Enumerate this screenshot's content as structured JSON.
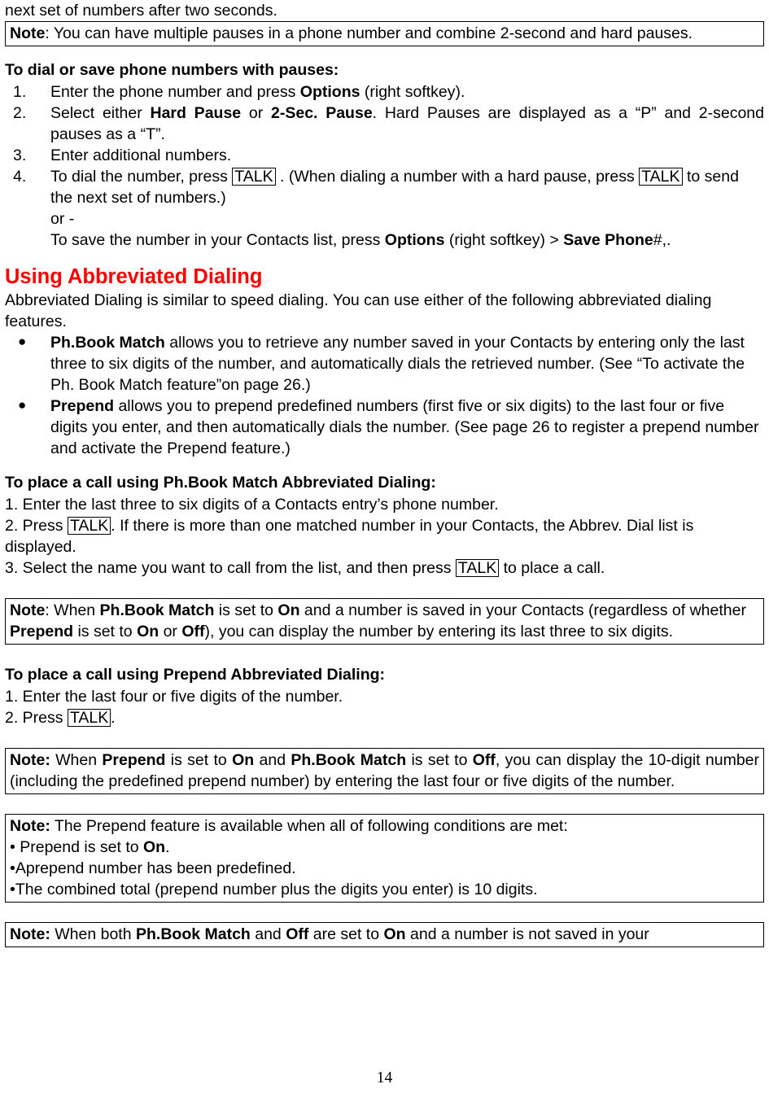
{
  "page": {
    "number": "14"
  },
  "top_fragment": "next set of numbers after two seconds.",
  "note1": {
    "label": "Note",
    "colon": ": ",
    "text": "You can have multiple pauses in a phone number and combine 2-second and hard pauses."
  },
  "section_dial": {
    "heading": "To dial or save phone numbers with pauses:",
    "steps": [
      {
        "num": "1.",
        "parts": [
          {
            "t": "Enter the phone number and press ",
            "style": "normal"
          },
          {
            "t": "Options",
            "style": "bold"
          },
          {
            "t": " (right softkey).",
            "style": "normal"
          }
        ]
      },
      {
        "num": "2.",
        "parts": [
          {
            "t": "Select either ",
            "style": "normal"
          },
          {
            "t": "Hard Pause",
            "style": "bold"
          },
          {
            "t": " or ",
            "style": "normal"
          },
          {
            "t": "2-Sec. Pause",
            "style": "bold"
          },
          {
            "t": ". Hard Pauses are displayed as a “P” and 2-second pauses as a “T”.",
            "style": "normal"
          }
        ]
      },
      {
        "num": "3.",
        "parts": [
          {
            "t": "Enter additional numbers.",
            "style": "normal"
          }
        ]
      }
    ],
    "step4": {
      "num": "4.",
      "a_pre": "To dial the number, press ",
      "a_key1": "TALK",
      "a_mid": " . (When dialing a number with a hard pause, press ",
      "a_key2": "TALK",
      "a_post": "to send the next set of numbers.)",
      "or": "or -",
      "b_pre": "To save the number in your Contacts list, press ",
      "b_bold1": "Options",
      "b_mid": " (right softkey) > ",
      "b_bold2": "Save Phone",
      "b_post": "#,."
    }
  },
  "section_abbrev": {
    "heading": "Using Abbreviated Dialing",
    "intro": "Abbreviated Dialing is similar to speed dialing. You can use either of the following abbreviated dialing features.",
    "bullets": [
      {
        "marker": "●",
        "parts": [
          {
            "t": "Ph.Book Match",
            "style": "bold"
          },
          {
            "t": " allows you to retrieve any number saved in your Contacts by entering only the last three to six digits of the number, and automatically dials the retrieved number. (See “To activate the Ph. Book Match feature”on page 26.)",
            "style": "normal"
          }
        ]
      },
      {
        "marker": "●",
        "parts": [
          {
            "t": "Prepend",
            "style": "bold"
          },
          {
            "t": " allows you to prepend predefined numbers (first five or six digits) to the last four or five digits you enter, and then automatically dials the number. (See page 26 to register a prepend number and activate the Prepend feature.)",
            "style": "normal"
          }
        ]
      }
    ]
  },
  "section_phbook": {
    "heading": "To place a call using Ph.Book Match Abbreviated Dialing:",
    "step1": "1. Enter the last three to six digits of a Contacts entry’s phone number.",
    "step2_pre": "2. Press ",
    "step2_key": "TALK",
    "step2_post": ". If there is more than one matched number in your Contacts, the Abbrev. Dial list is displayed.",
    "step3_pre": "3. Select the name you want to call from the list, and then press ",
    "step3_key": "TALK",
    "step3_post": " to place a call."
  },
  "note2": {
    "label": "Note",
    "parts": [
      {
        "t": "Note",
        "style": "bold"
      },
      {
        "t": ": When ",
        "style": "normal"
      },
      {
        "t": "Ph.Book Match",
        "style": "bold"
      },
      {
        "t": " is set to ",
        "style": "normal"
      },
      {
        "t": "On",
        "style": "bold"
      },
      {
        "t": " and a number is saved in your Contacts (regardless of whether ",
        "style": "normal"
      },
      {
        "t": "Prepend",
        "style": "bold"
      },
      {
        "t": " is set to ",
        "style": "normal"
      },
      {
        "t": "On",
        "style": "bold"
      },
      {
        "t": " or ",
        "style": "normal"
      },
      {
        "t": "Off",
        "style": "bold"
      },
      {
        "t": "), you can display the number by entering its last three to six digits.",
        "style": "normal"
      }
    ]
  },
  "section_prepend": {
    "heading": "To place a call using Prepend Abbreviated Dialing:",
    "step1": "1. Enter the last four or five digits of the number.",
    "step2_pre": "2. Press ",
    "step2_key": "TALK",
    "step2_post": "."
  },
  "note3": {
    "parts": [
      {
        "t": "Note:",
        "style": "bold"
      },
      {
        "t": " When ",
        "style": "normal"
      },
      {
        "t": "Prepend",
        "style": "bold"
      },
      {
        "t": " is set to ",
        "style": "normal"
      },
      {
        "t": "On",
        "style": "bold"
      },
      {
        "t": " and ",
        "style": "normal"
      },
      {
        "t": "Ph.Book Match",
        "style": "bold"
      },
      {
        "t": " is set to ",
        "style": "normal"
      },
      {
        "t": "Off",
        "style": "bold"
      },
      {
        "t": ", you can display the 10-digit number (including the predefined prepend number) by entering the last four or five digits of the number.",
        "style": "normal"
      }
    ]
  },
  "note4": {
    "line1_parts": [
      {
        "t": "Note:",
        "style": "bold"
      },
      {
        "t": " The Prepend feature is available when all of following conditions are met:",
        "style": "normal"
      }
    ],
    "line2_parts": [
      {
        "t": "• Prepend is set to ",
        "style": "normal"
      },
      {
        "t": "On",
        "style": "bold"
      },
      {
        "t": ".",
        "style": "normal"
      }
    ],
    "line3": "•Aprepend number has been predefined.",
    "line4": "•The combined total (prepend number plus the digits you enter) is 10 digits."
  },
  "note5": {
    "parts": [
      {
        "t": "Note:",
        "style": "bold"
      },
      {
        "t": " When both ",
        "style": "normal"
      },
      {
        "t": "Ph.Book Match",
        "style": "bold"
      },
      {
        "t": " and ",
        "style": "normal"
      },
      {
        "t": "Off",
        "style": "bold"
      },
      {
        "t": " are set to ",
        "style": "normal"
      },
      {
        "t": "On",
        "style": "bold"
      },
      {
        "t": " and a number is not saved in your",
        "style": "normal"
      }
    ]
  },
  "colors": {
    "heading_red": "#ff0000",
    "text": "#000000",
    "background": "#ffffff",
    "border": "#000000"
  }
}
